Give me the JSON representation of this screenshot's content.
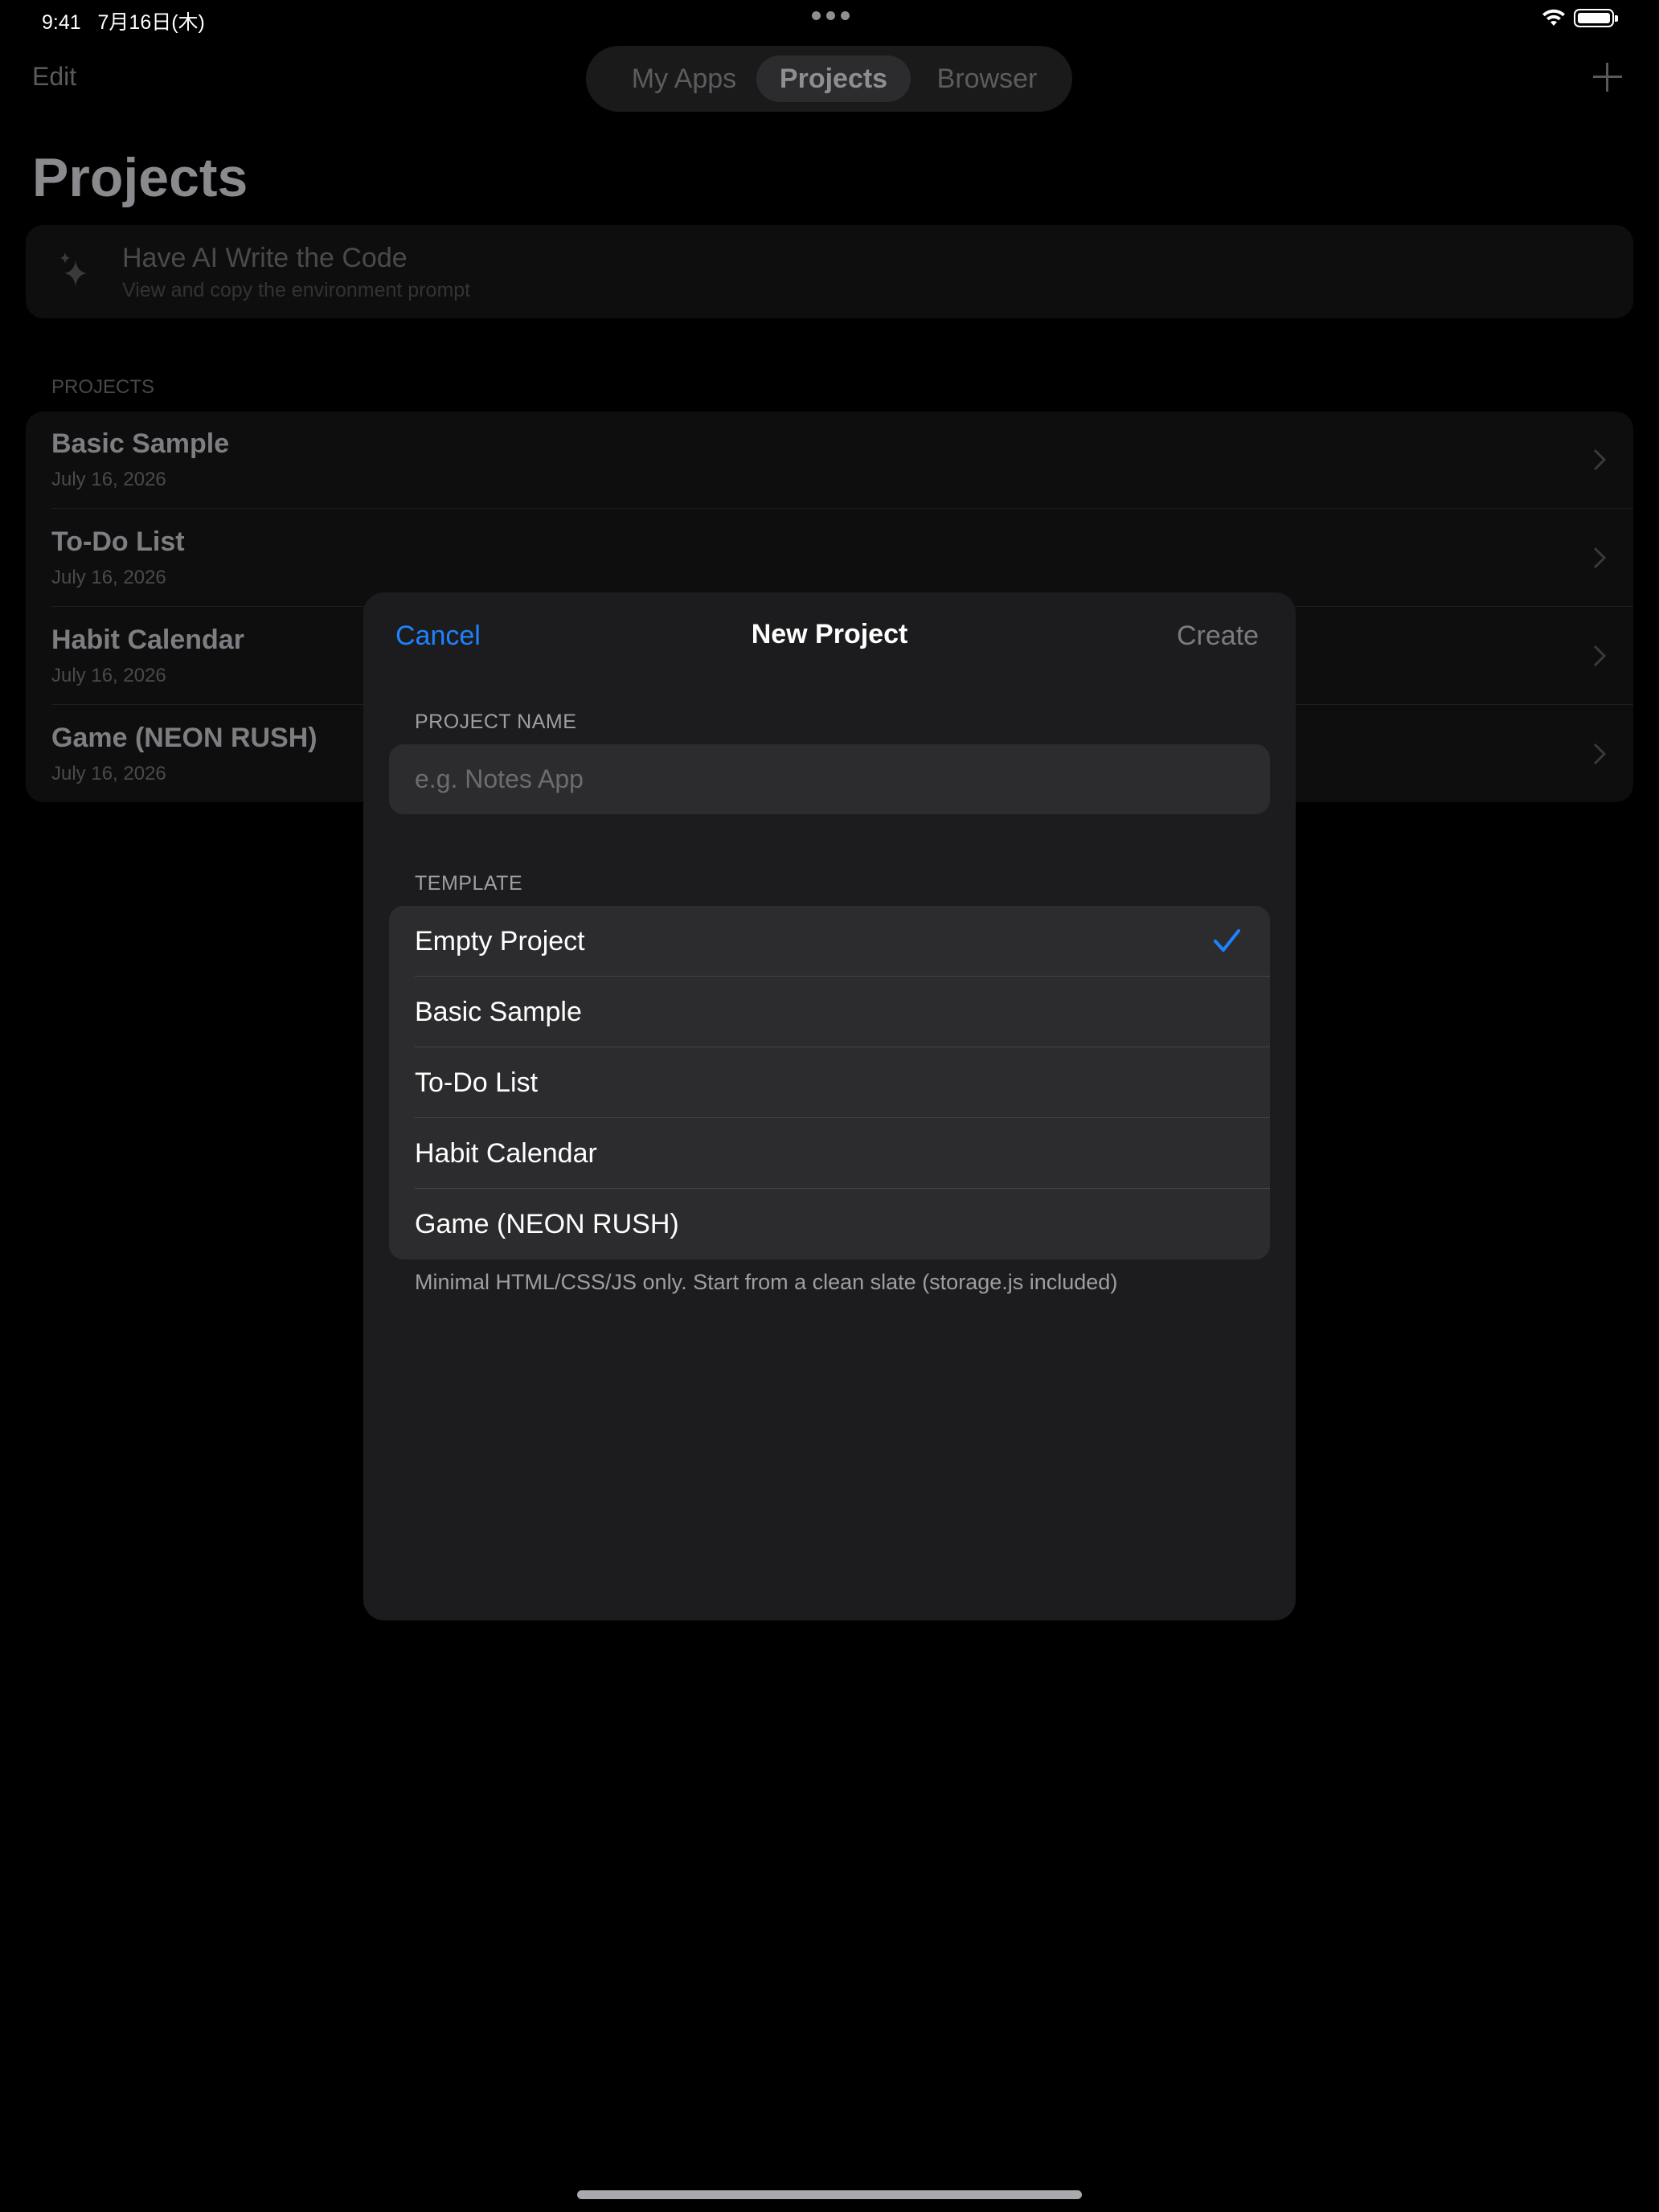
{
  "status_bar": {
    "time": "9:41",
    "date": "7月16日(木)"
  },
  "nav": {
    "edit_label": "Edit",
    "tabs": [
      {
        "label": "My Apps",
        "selected": false
      },
      {
        "label": "Projects",
        "selected": true
      },
      {
        "label": "Browser",
        "selected": false
      }
    ]
  },
  "page": {
    "title": "Projects",
    "ai_card": {
      "title": "Have AI Write the Code",
      "subtitle": "View and copy the environment prompt"
    },
    "section_label": "PROJECTS",
    "projects": [
      {
        "name": "Basic Sample",
        "date": "July 16, 2026"
      },
      {
        "name": "To-Do List",
        "date": "July 16, 2026"
      },
      {
        "name": "Habit Calendar",
        "date": "July 16, 2026"
      },
      {
        "name": "Game (NEON RUSH)",
        "date": "July 16, 2026"
      }
    ]
  },
  "modal": {
    "cancel_label": "Cancel",
    "title": "New Project",
    "create_label": "Create",
    "project_name_label": "PROJECT NAME",
    "project_name_placeholder": "e.g. Notes App",
    "project_name_value": "",
    "template_label": "TEMPLATE",
    "templates": [
      {
        "label": "Empty Project",
        "selected": true
      },
      {
        "label": "Basic Sample",
        "selected": false
      },
      {
        "label": "To-Do List",
        "selected": false
      },
      {
        "label": "Habit Calendar",
        "selected": false
      },
      {
        "label": "Game (NEON RUSH)",
        "selected": false
      }
    ],
    "template_description": "Minimal HTML/CSS/JS only. Start from a clean slate (storage.js included)"
  },
  "colors": {
    "accent": "#1e82ff",
    "modal_bg": "#1c1c1e",
    "row_bg": "#2c2c2e"
  }
}
